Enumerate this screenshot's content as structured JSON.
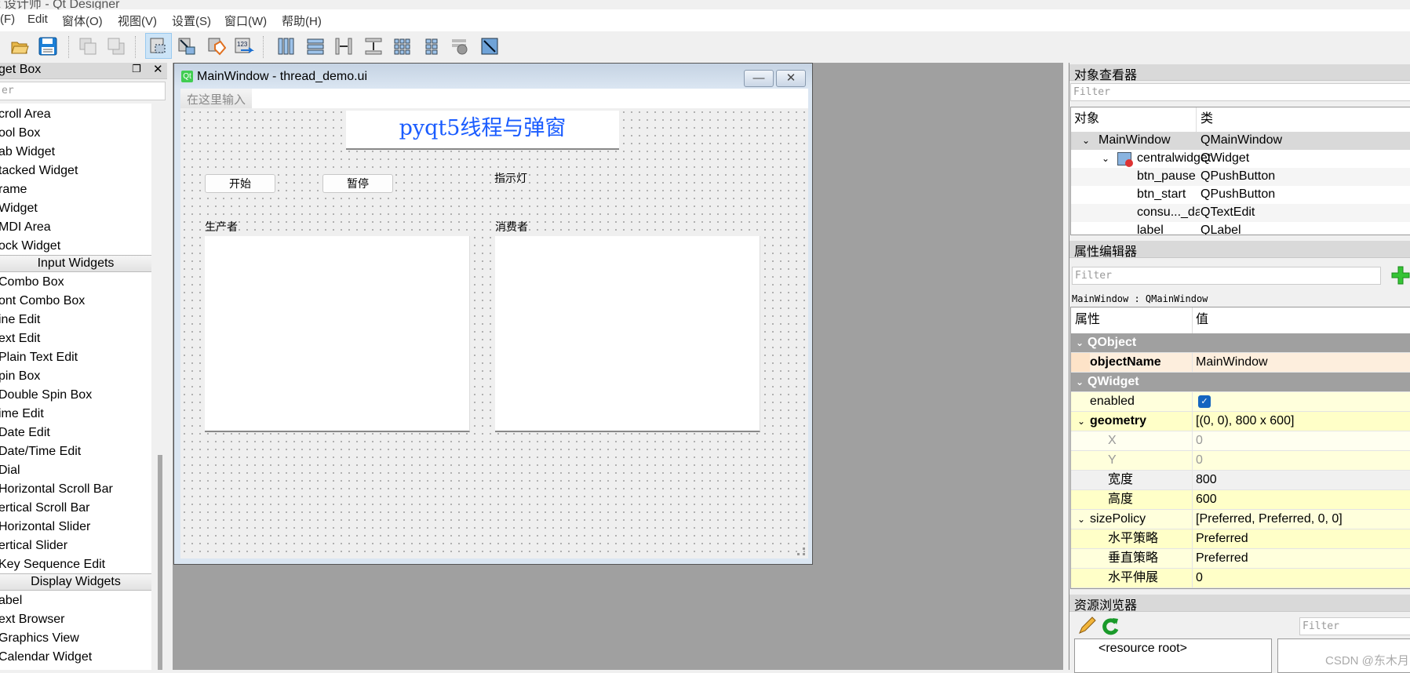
{
  "app_title": "t 设计师 - Qt Designer",
  "menu": [
    "(F)",
    "Edit",
    "窗体(O)",
    "视图(V)",
    "设置(S)",
    "窗口(W)",
    "帮助(H)"
  ],
  "toolbar": {
    "icons": [
      "open-icon",
      "save-icon",
      "bring-front-icon",
      "send-back-icon",
      "edit-widgets-icon",
      "edit-signals-slots-icon",
      "edit-buddies-icon",
      "edit-tab-order-icon",
      "layout-horizontal-icon",
      "layout-vertical-icon",
      "layout-splitter-horizontal-icon",
      "layout-splitter-vertical-icon",
      "layout-grid-icon",
      "layout-form-icon",
      "break-layout-icon",
      "adjust-size-icon"
    ],
    "active": "edit-widgets-icon"
  },
  "widget_box": {
    "title": "get Box",
    "filter_placeholder": "er",
    "items_a": [
      "croll Area",
      "ool Box",
      "ab Widget",
      "tacked Widget",
      "rame",
      "Widget",
      "MDI Area",
      "ock Widget"
    ],
    "cat_input": "Input Widgets",
    "items_b": [
      "Combo Box",
      "ont Combo Box",
      "ine Edit",
      "ext Edit",
      "Plain Text Edit",
      "pin Box",
      "Double Spin Box",
      "ime Edit",
      "Date Edit",
      "Date/Time Edit",
      "Dial",
      "Horizontal Scroll Bar",
      "ertical Scroll Bar",
      "Horizontal Slider",
      "ertical Slider",
      "Key Sequence Edit"
    ],
    "cat_display": "Display Widgets",
    "items_c": [
      "abel",
      "ext Browser",
      "Graphics View",
      "Calendar Widget"
    ]
  },
  "form_window": {
    "title": "MainWindow - thread_demo.ui",
    "qt_badge": "Qt",
    "menu_placeholder": "在这里输入",
    "heading": "pyqt5线程与弹窗",
    "heading_color": "#1a5cff",
    "btn_start": "开始",
    "btn_pause": "暂停",
    "indicator": "指示灯",
    "producer": "生产者",
    "consumer": "消费者",
    "minimize": "—",
    "close": "✕"
  },
  "object_inspector": {
    "title": "对象查看器",
    "filter_placeholder": "Filter",
    "col_object": "对象",
    "col_class": "类",
    "rows": [
      {
        "name": "MainWindow",
        "cls": "QMainWindow"
      },
      {
        "name": "centralwidget",
        "cls": "QWidget"
      },
      {
        "name": "btn_pause",
        "cls": "QPushButton"
      },
      {
        "name": "btn_start",
        "cls": "QPushButton"
      },
      {
        "name": "consu..._data",
        "cls": "QTextEdit"
      },
      {
        "name": "label",
        "cls": "QLabel"
      }
    ]
  },
  "property_editor": {
    "title": "属性编辑器",
    "filter_placeholder": "Filter",
    "context": "MainWindow : QMainWindow",
    "col_prop": "属性",
    "col_value": "值",
    "group_qobject": "QObject",
    "group_qwidget": "QWidget",
    "rows": [
      {
        "name": "objectName",
        "value": "MainWindow"
      },
      {
        "name": "enabled",
        "value": "",
        "checked": true
      },
      {
        "name": "geometry",
        "value": "[(0, 0), 800 x 600]"
      },
      {
        "name": "X",
        "value": "0"
      },
      {
        "name": "Y",
        "value": "0"
      },
      {
        "name": "宽度",
        "value": "800"
      },
      {
        "name": "高度",
        "value": "600"
      },
      {
        "name": "sizePolicy",
        "value": "[Preferred, Preferred, 0, 0]"
      },
      {
        "name": "水平策略",
        "value": "Preferred"
      },
      {
        "name": "垂直策略",
        "value": "Preferred"
      },
      {
        "name": "水平伸展",
        "value": "0"
      }
    ]
  },
  "resource_browser": {
    "title": "资源浏览器",
    "filter_placeholder": "Filter",
    "root": "<resource root>"
  },
  "watermark": "CSDN @东木月"
}
